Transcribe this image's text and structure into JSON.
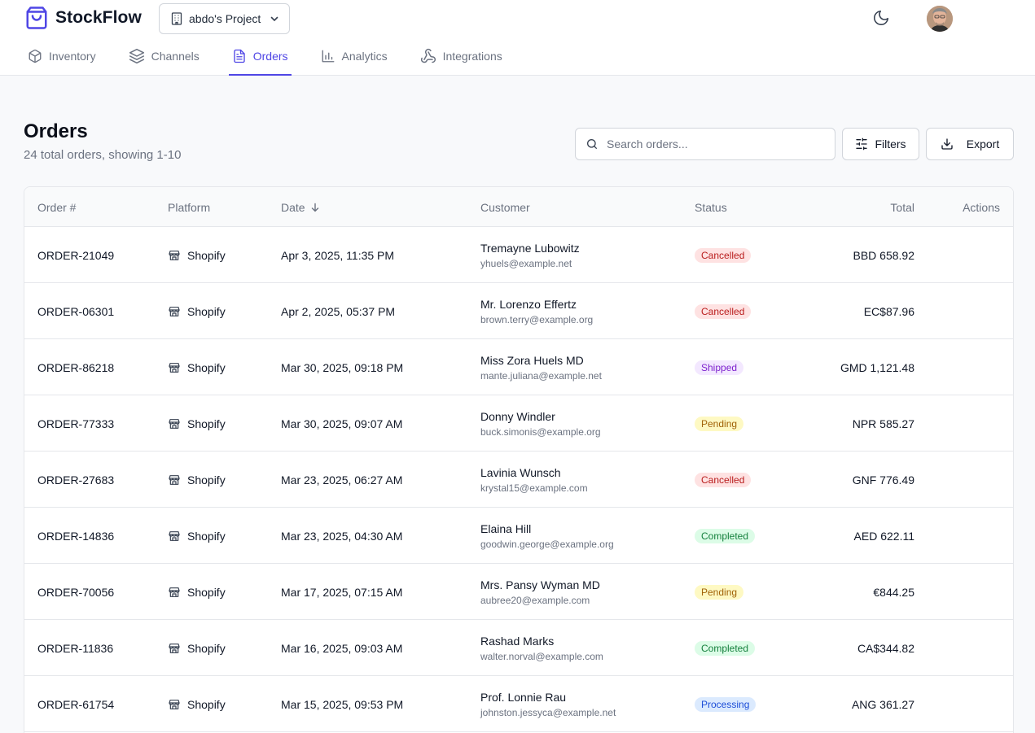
{
  "app": {
    "name": "StockFlow",
    "project": "abdo's Project"
  },
  "nav": {
    "tabs": [
      {
        "label": "Inventory",
        "icon": "box-icon"
      },
      {
        "label": "Channels",
        "icon": "layers-icon"
      },
      {
        "label": "Orders",
        "icon": "document-icon",
        "active": true
      },
      {
        "label": "Analytics",
        "icon": "bar-chart-icon"
      },
      {
        "label": "Integrations",
        "icon": "webhook-icon"
      }
    ]
  },
  "page": {
    "title": "Orders",
    "subtitle": "24 total orders, showing 1-10",
    "search_placeholder": "Search orders...",
    "filters_label": "Filters",
    "export_label": "Export"
  },
  "table": {
    "columns": {
      "order": "Order #",
      "platform": "Platform",
      "date": "Date",
      "customer": "Customer",
      "status": "Status",
      "total": "Total",
      "actions": "Actions"
    },
    "rows": [
      {
        "order": "ORDER-21049",
        "platform": "Shopify",
        "date": "Apr 3, 2025, 11:35 PM",
        "name": "Tremayne Lubowitz",
        "email": "yhuels@example.net",
        "status": "Cancelled",
        "status_key": "cancelled",
        "total": "BBD 658.92"
      },
      {
        "order": "ORDER-06301",
        "platform": "Shopify",
        "date": "Apr 2, 2025, 05:37 PM",
        "name": "Mr. Lorenzo Effertz",
        "email": "brown.terry@example.org",
        "status": "Cancelled",
        "status_key": "cancelled",
        "total": "EC$87.96"
      },
      {
        "order": "ORDER-86218",
        "platform": "Shopify",
        "date": "Mar 30, 2025, 09:18 PM",
        "name": "Miss Zora Huels MD",
        "email": "mante.juliana@example.net",
        "status": "Shipped",
        "status_key": "shipped",
        "total": "GMD 1,121.48"
      },
      {
        "order": "ORDER-77333",
        "platform": "Shopify",
        "date": "Mar 30, 2025, 09:07 AM",
        "name": "Donny Windler",
        "email": "buck.simonis@example.org",
        "status": "Pending",
        "status_key": "pending",
        "total": "NPR 585.27"
      },
      {
        "order": "ORDER-27683",
        "platform": "Shopify",
        "date": "Mar 23, 2025, 06:27 AM",
        "name": "Lavinia Wunsch",
        "email": "krystal15@example.com",
        "status": "Cancelled",
        "status_key": "cancelled",
        "total": "GNF 776.49"
      },
      {
        "order": "ORDER-14836",
        "platform": "Shopify",
        "date": "Mar 23, 2025, 04:30 AM",
        "name": "Elaina Hill",
        "email": "goodwin.george@example.org",
        "status": "Completed",
        "status_key": "completed",
        "total": "AED 622.11"
      },
      {
        "order": "ORDER-70056",
        "platform": "Shopify",
        "date": "Mar 17, 2025, 07:15 AM",
        "name": "Mrs. Pansy Wyman MD",
        "email": "aubree20@example.com",
        "status": "Pending",
        "status_key": "pending",
        "total": "€844.25"
      },
      {
        "order": "ORDER-11836",
        "platform": "Shopify",
        "date": "Mar 16, 2025, 09:03 AM",
        "name": "Rashad Marks",
        "email": "walter.norval@example.com",
        "status": "Completed",
        "status_key": "completed",
        "total": "CA$344.82"
      },
      {
        "order": "ORDER-61754",
        "platform": "Shopify",
        "date": "Mar 15, 2025, 09:53 PM",
        "name": "Prof. Lonnie Rau",
        "email": "johnston.jessyca@example.net",
        "status": "Processing",
        "status_key": "processing",
        "total": "ANG 361.27"
      }
    ]
  },
  "colors": {
    "accent": "#4f46e5",
    "border": "#e5e7eb",
    "muted_text": "#6b7280"
  }
}
